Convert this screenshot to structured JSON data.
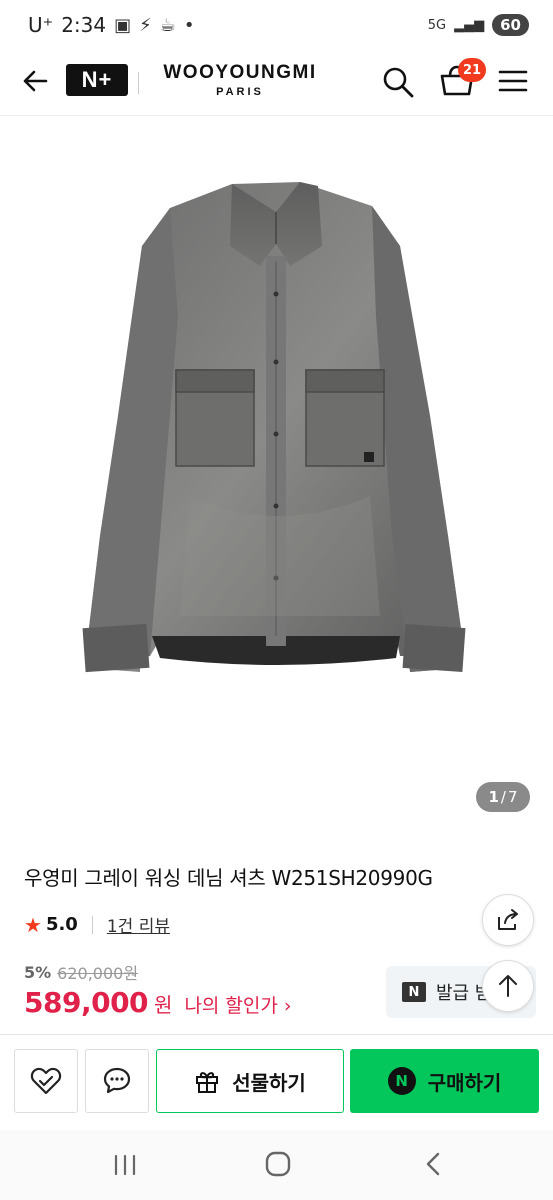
{
  "status_bar": {
    "carrier": "U⁺",
    "time": "2:34",
    "network": "5G",
    "battery": "60"
  },
  "header": {
    "nplus_label": "N+",
    "brand_name": "WOOYOUNGMI",
    "brand_sub": "PARIS",
    "cart_count": "21"
  },
  "gallery": {
    "current": "1",
    "separator": "/",
    "total": "7"
  },
  "product": {
    "title": "우영미 그레이 워싱 데님 셔츠 W251SH20990G",
    "rating": "5.0",
    "review_label": "1건 리뷰",
    "discount_rate": "5%",
    "original_price": "620,000원",
    "sale_price": "589,000",
    "currency": "원",
    "my_discount_label": "나의 할인가 ›"
  },
  "coupon": {
    "badge": "N",
    "label": "발급 받"
  },
  "actions": {
    "gift_label": "선물하기",
    "buy_badge": "N",
    "buy_label": "구매하기"
  },
  "colors": {
    "accent_green": "#03c75a",
    "price_red": "#e0224a",
    "badge_red": "#f13a1e"
  },
  "icons": [
    "back-arrow-icon",
    "search-icon",
    "shopping-basket-icon",
    "hamburger-menu-icon",
    "star-icon",
    "share-icon",
    "arrow-up-icon",
    "heart-check-icon",
    "chat-bubble-icon",
    "gift-icon"
  ]
}
